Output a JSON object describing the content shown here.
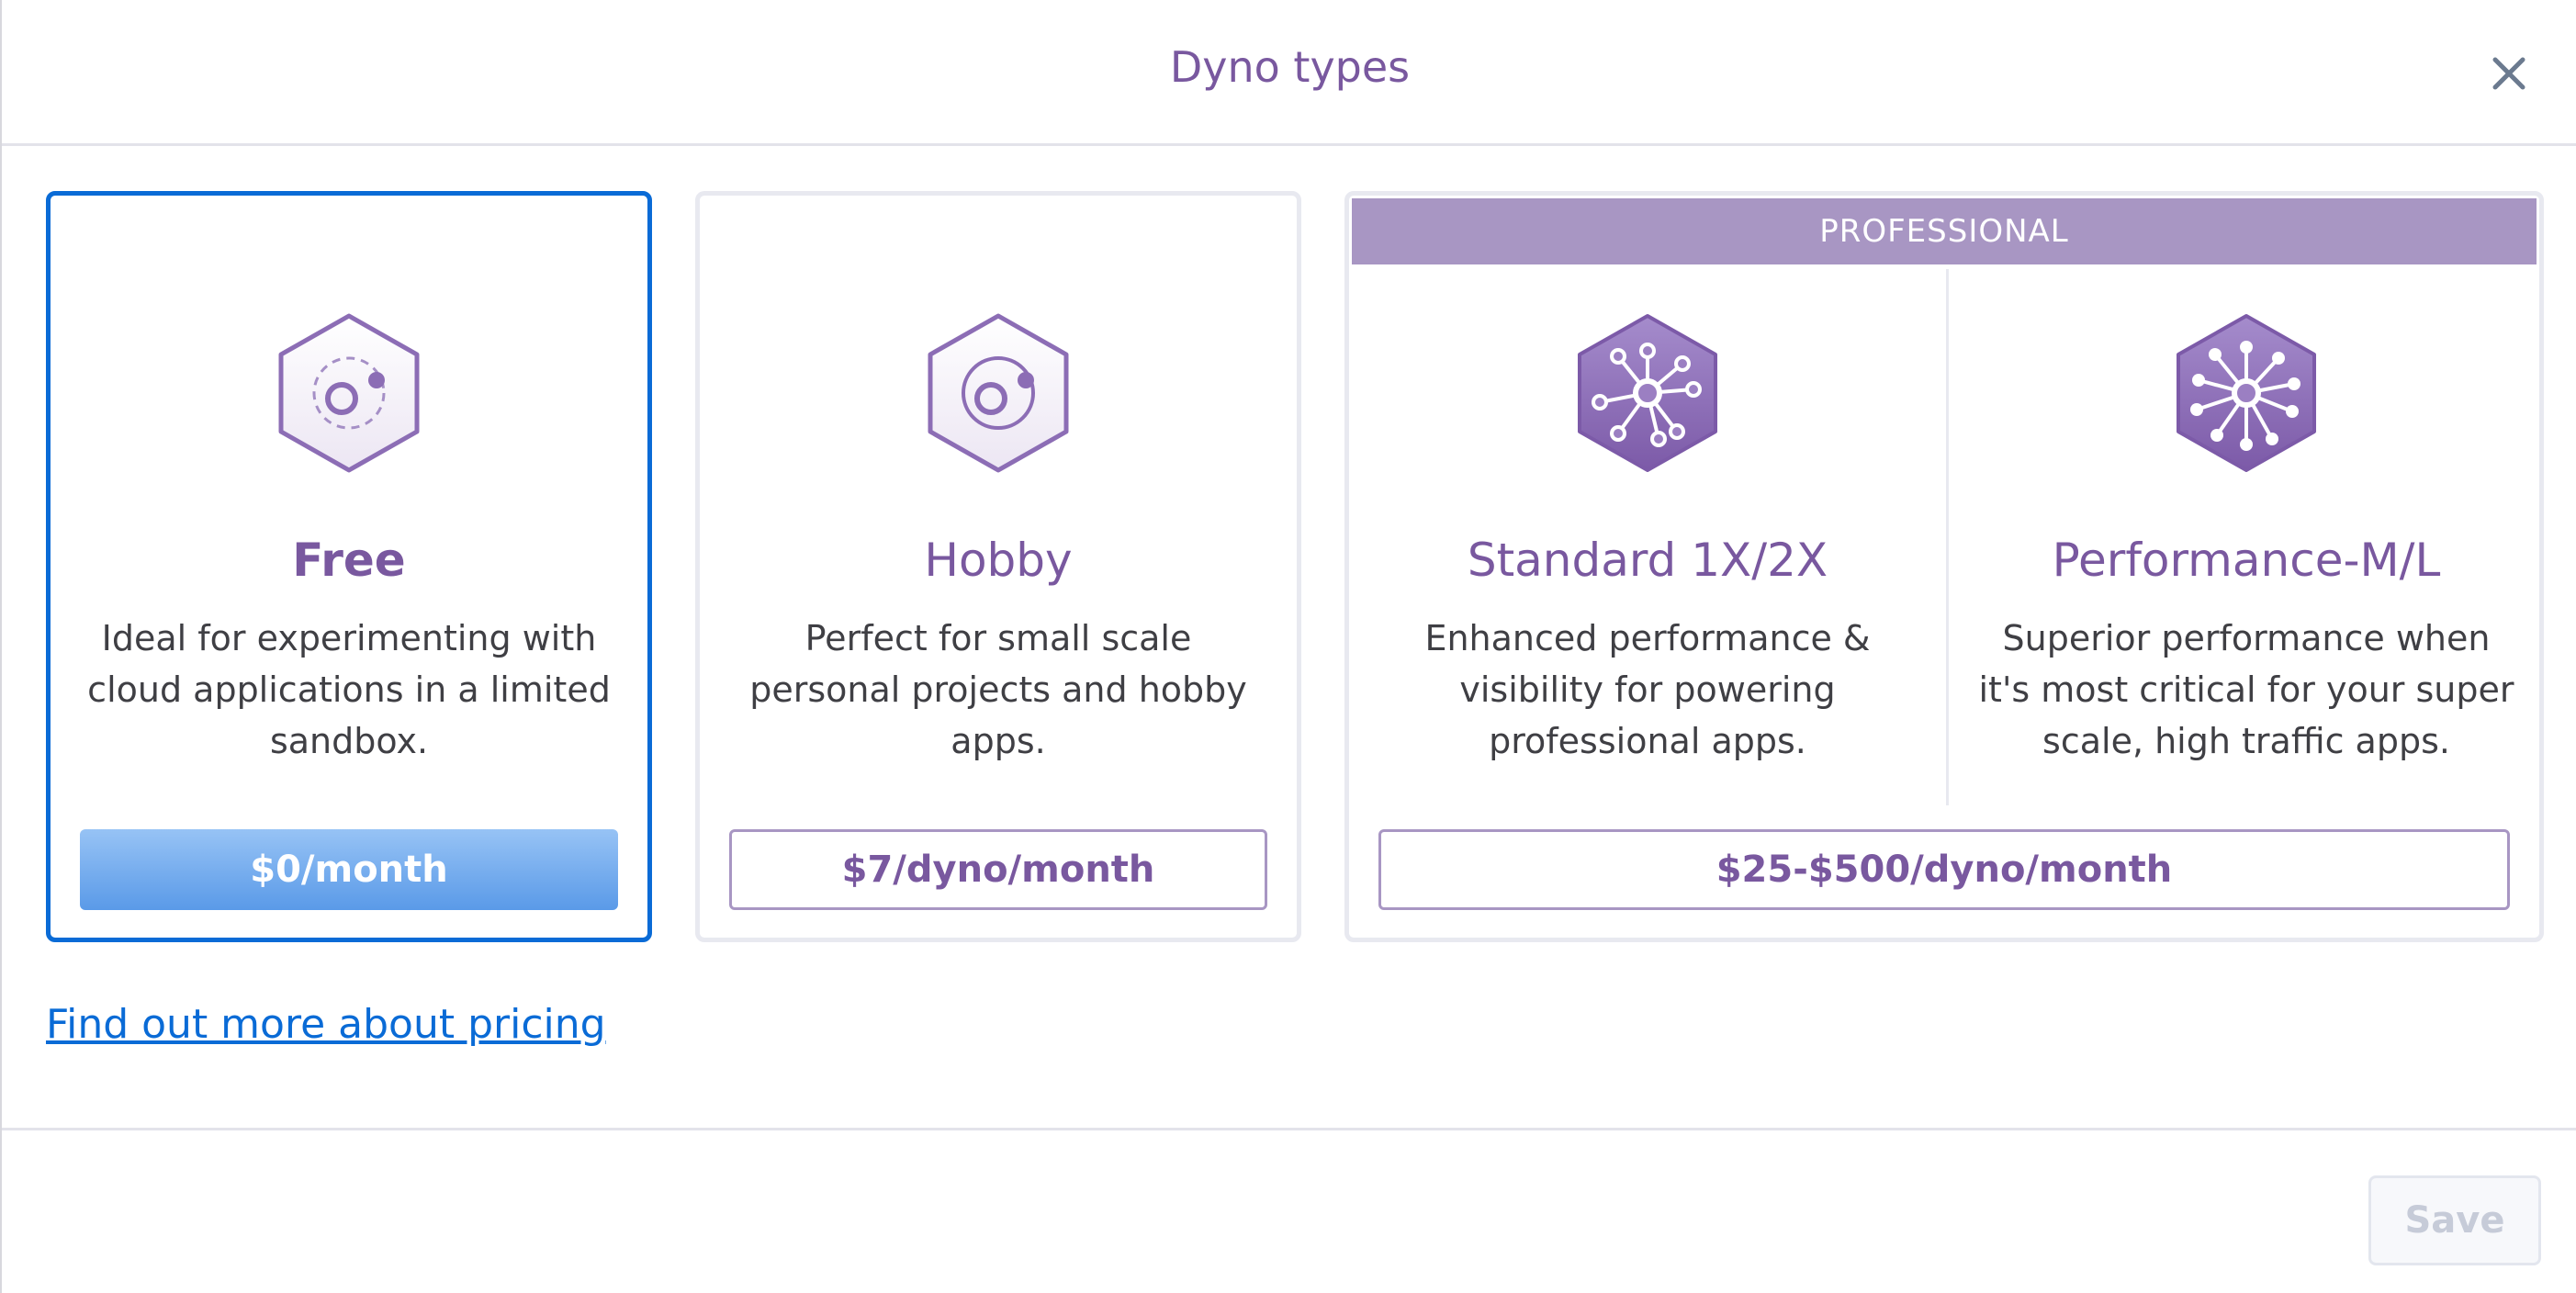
{
  "modal": {
    "title": "Dyno types",
    "close_icon": "close-icon"
  },
  "tiers": {
    "free": {
      "name": "Free",
      "description": "Ideal for experimenting with cloud applications in a limited sandbox.",
      "price": "$0/month",
      "selected": true,
      "icon": "dyno-free-icon"
    },
    "hobby": {
      "name": "Hobby",
      "description": "Perfect for small scale personal projects and hobby apps.",
      "price": "$7/dyno/month",
      "icon": "dyno-hobby-icon"
    },
    "professional": {
      "banner": "PROFESSIONAL",
      "price": "$25-$500/dyno/month",
      "standard": {
        "name": "Standard 1X/2X",
        "description": "Enhanced performance & visibility for powering professional apps.",
        "icon": "dyno-standard-icon"
      },
      "performance": {
        "name": "Performance-M/L",
        "description": "Superior performance when it's most critical for your super scale, high traffic apps.",
        "icon": "dyno-performance-icon"
      }
    }
  },
  "footer": {
    "pricing_link": "Find out more about pricing",
    "save_label": "Save"
  },
  "colors": {
    "accent_purple": "#79589f",
    "selected_border": "#0a6bd6",
    "banner_purple": "#a896c3"
  }
}
